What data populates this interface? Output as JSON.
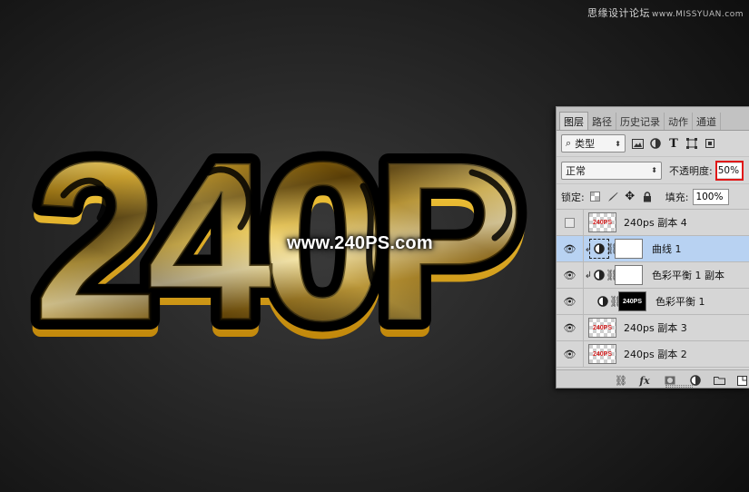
{
  "artwork": {
    "main_text": "240P",
    "caption": "www.240PS.com",
    "watermark_cn": "思缘设计论坛",
    "watermark_url": "www.MISSYUAN.com",
    "colors": {
      "gold_light": "#fff3a8",
      "gold_mid": "#c99a1a",
      "gold_dark": "#4a3304",
      "outline": "#000000"
    }
  },
  "layers_panel": {
    "tabs": [
      {
        "label": "图层",
        "active": true
      },
      {
        "label": "路径",
        "active": false
      },
      {
        "label": "历史记录",
        "active": false
      },
      {
        "label": "动作",
        "active": false
      },
      {
        "label": "通道",
        "active": false
      }
    ],
    "filter": {
      "icon": "search-icon",
      "label": "类型"
    },
    "blend_mode": "正常",
    "opacity_label": "不透明度:",
    "opacity_value": "50%",
    "lock_label": "锁定:",
    "fill_label": "填充:",
    "fill_value": "100%",
    "layers": [
      {
        "name": "240ps 副本 4",
        "visible": false,
        "selected": false,
        "kind": "pixel",
        "thumb_text": "240PS"
      },
      {
        "name": "曲线 1",
        "visible": true,
        "selected": true,
        "kind": "adjustment",
        "clipped": true
      },
      {
        "name": "色彩平衡 1 副本",
        "visible": true,
        "selected": false,
        "kind": "adjustment",
        "clipped": true
      },
      {
        "name": "色彩平衡 1",
        "visible": true,
        "selected": false,
        "kind": "adjustment-black",
        "clipped": false,
        "thumb_text": "240PS"
      },
      {
        "name": "240ps 副本 3",
        "visible": true,
        "selected": false,
        "kind": "pixel",
        "thumb_text": "240PS"
      },
      {
        "name": "240ps 副本 2",
        "visible": true,
        "selected": false,
        "kind": "pixel",
        "thumb_text": "240PS"
      }
    ],
    "footer_icons": [
      "link-icon",
      "fx-icon",
      "mask-icon",
      "adjustment-icon",
      "folder-icon",
      "new-layer-icon"
    ],
    "accent_highlight": "#e01818",
    "selected_row_color": "#b8d2f2"
  }
}
